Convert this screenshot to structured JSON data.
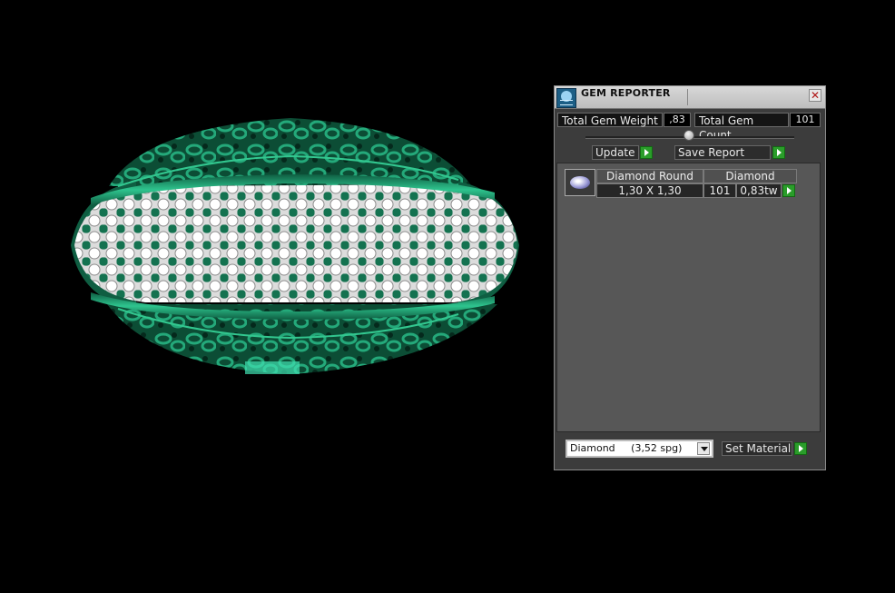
{
  "panel": {
    "title": "GEM REPORTER",
    "close_glyph": "✕",
    "total_weight_label": "Total Gem Weight",
    "total_weight_value": ",83",
    "total_count_label": "Total Gem Count",
    "total_count_value": "101",
    "update_label": "Update",
    "save_report_label": "Save Report",
    "columns": [
      "Diamond Round",
      "Diamond"
    ],
    "rows": [
      {
        "size": "1,30 X 1,30",
        "count": "101",
        "weight": "0,83tw"
      }
    ],
    "material_value": "Diamond     (3,52 spg)",
    "set_material_label": "Set Material"
  },
  "icons": {
    "app": "gem-reporter-app-icon",
    "close": "close-icon",
    "play": "play-arrow-icon",
    "dropdown": "chevron-down-icon"
  },
  "colors": {
    "ring_green": "#1a7a5a",
    "panel_bg": "#3c3c3c",
    "accent_green": "#2a9d2a"
  }
}
